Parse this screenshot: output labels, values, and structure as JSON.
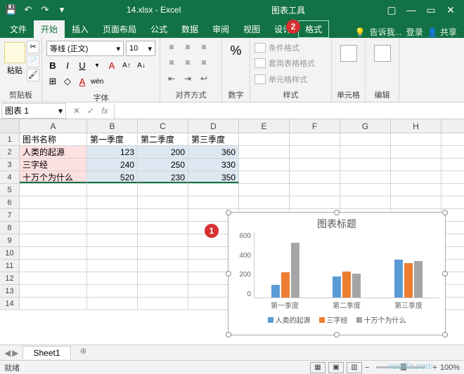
{
  "title": "14.xlsx - Excel",
  "toolTitle": "图表工具",
  "tabs": {
    "file": "文件",
    "home": "开始",
    "insert": "插入",
    "layout": "页面布局",
    "formulas": "公式",
    "data": "数据",
    "review": "审阅",
    "view": "视图",
    "design": "设计",
    "format": "格式"
  },
  "tell": "告诉我...",
  "login": "登录",
  "share": "共享",
  "ribbon": {
    "paste": "粘贴",
    "clipboard": "剪贴板",
    "fontName": "等线 (正文)",
    "fontSize": "10",
    "fontGroup": "字体",
    "alignGroup": "对齐方式",
    "numberGroup": "数字",
    "condFmt": "条件格式",
    "tblFmt": "套用表格格式",
    "cellStyle": "单元格样式",
    "stylesGroup": "样式",
    "cellsGroup": "单元格",
    "editGroup": "编辑"
  },
  "nameBox": "图表 1",
  "cols": [
    "A",
    "B",
    "C",
    "D",
    "E",
    "F",
    "G",
    "H"
  ],
  "headers": {
    "a": "图书名称",
    "b": "第一季度",
    "c": "第二季度",
    "d": "第三季度"
  },
  "rows": [
    {
      "a": "人类的起源",
      "b": "123",
      "c": "200",
      "d": "360"
    },
    {
      "a": "三字经",
      "b": "240",
      "c": "250",
      "d": "330"
    },
    {
      "a": "十万个为什么",
      "b": "520",
      "c": "230",
      "d": "350"
    }
  ],
  "chart_data": {
    "type": "bar",
    "title": "图表标题",
    "categories": [
      "第一季度",
      "第二季度",
      "第三季度"
    ],
    "series": [
      {
        "name": "人类的起源",
        "values": [
          123,
          200,
          360
        ],
        "color": "#5b9bd5"
      },
      {
        "name": "三字经",
        "values": [
          240,
          250,
          330
        ],
        "color": "#ed7d31"
      },
      {
        "name": "十万个为什么",
        "values": [
          520,
          230,
          350
        ],
        "color": "#a5a5a5"
      }
    ],
    "ylim": [
      0,
      600
    ],
    "yticks": [
      0,
      200,
      400,
      600
    ]
  },
  "sheet": "Sheet1",
  "statusText": "就绪",
  "zoom": "100%",
  "watermark": "xuelila.com",
  "callouts": {
    "c1": "1",
    "c2": "2"
  }
}
